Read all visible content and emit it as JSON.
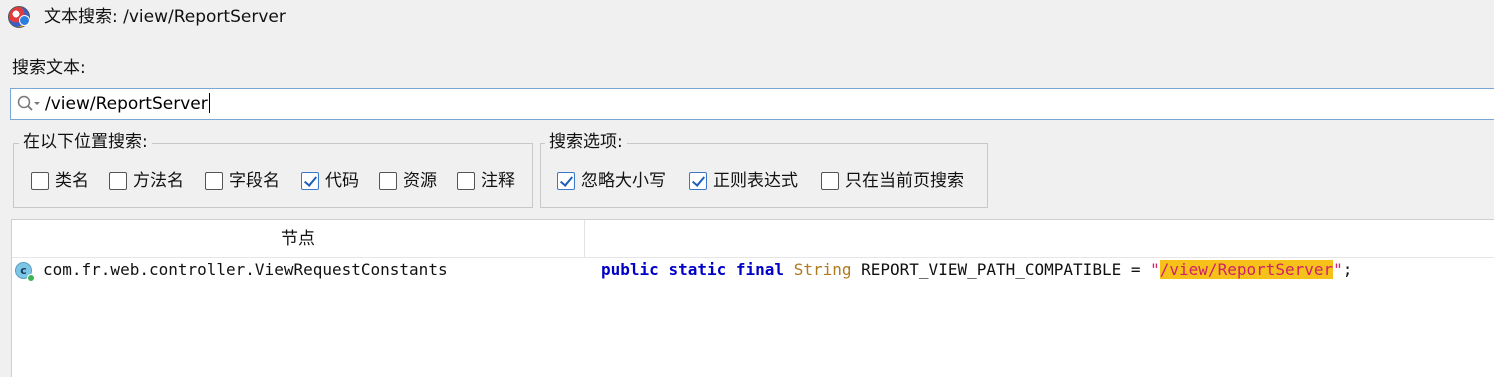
{
  "window": {
    "title": "文本搜索: /view/ReportServer"
  },
  "search": {
    "label": "搜索文本:",
    "value": "/view/ReportServer"
  },
  "location_group": {
    "legend": "在以下位置搜索:",
    "options": [
      {
        "label": "类名",
        "checked": false
      },
      {
        "label": "方法名",
        "checked": false
      },
      {
        "label": "字段名",
        "checked": false
      },
      {
        "label": "代码",
        "checked": true
      },
      {
        "label": "资源",
        "checked": false
      },
      {
        "label": "注释",
        "checked": false
      }
    ]
  },
  "options_group": {
    "legend": "搜索选项:",
    "options": [
      {
        "label": "忽略大小写",
        "checked": true
      },
      {
        "label": "正则表达式",
        "checked": true
      },
      {
        "label": "只在当前页搜索",
        "checked": false
      }
    ]
  },
  "results": {
    "columns": [
      "节点",
      ""
    ],
    "rows": [
      {
        "icon": "class-icon",
        "icon_letter": "c",
        "node": "com.fr.web.controller.ViewRequestConstants",
        "code": {
          "kw1": "public",
          "kw2": "static",
          "kw3": "final",
          "type": "String",
          "name": "REPORT_VIEW_PATH_COMPATIBLE",
          "eq": " = ",
          "quote": "\"",
          "match": "/view/ReportServer",
          "end": ";"
        }
      }
    ]
  },
  "colors": {
    "match_highlight": "#f6c21a",
    "keyword": "#0000c8",
    "string": "#d0206a",
    "type": "#b07a1f"
  }
}
